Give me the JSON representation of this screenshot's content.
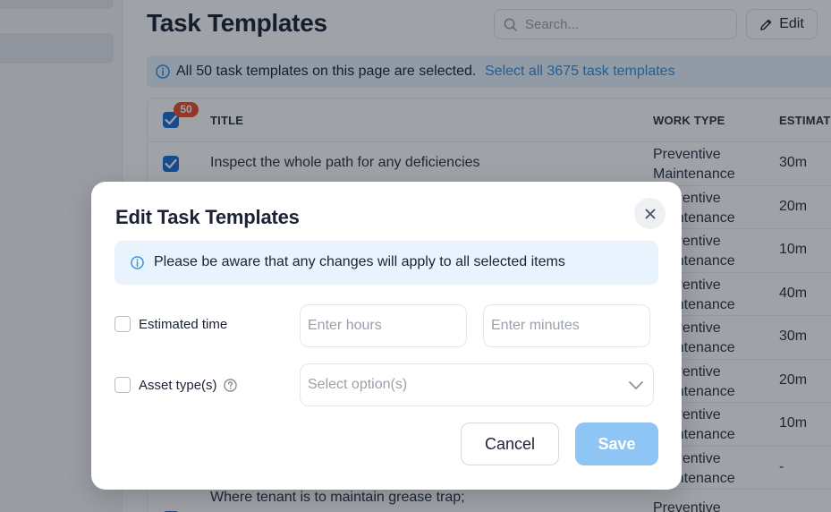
{
  "header": {
    "title": "Task Templates",
    "search_placeholder": "Search...",
    "edit_label": "Edit"
  },
  "selection_banner": {
    "text": "All 50 task templates on this page are selected.",
    "link": "Select all 3675 task templates"
  },
  "table": {
    "selected_count": "50",
    "columns": [
      "TITLE",
      "WORK TYPE",
      "ESTIMATE"
    ],
    "rows": [
      {
        "title": "Inspect the whole path for any deficiencies",
        "work_type": "Preventive Maintenance",
        "estimate": "30m"
      },
      {
        "title": "",
        "work_type": "Preventive Maintenance",
        "estimate": "20m"
      },
      {
        "title": "",
        "work_type": "Preventive Maintenance",
        "estimate": "10m"
      },
      {
        "title": "",
        "work_type": "Preventive Maintenance",
        "estimate": "40m"
      },
      {
        "title": "",
        "work_type": "Preventive Maintenance",
        "estimate": "30m"
      },
      {
        "title": "",
        "work_type": "Preventive Maintenance",
        "estimate": "20m"
      },
      {
        "title": "",
        "work_type": "Preventive Maintenance",
        "estimate": "10m"
      },
      {
        "title": "",
        "work_type": "Preventive Maintenance",
        "estimate": "-"
      },
      {
        "title": "Where tenant is to maintain grease trap;",
        "work_type": "Preventive",
        "estimate": ""
      }
    ]
  },
  "modal": {
    "title": "Edit Task Templates",
    "info": "Please be aware that any changes will apply to all selected items",
    "estimated_time_label": "Estimated time",
    "hours_placeholder": "Enter hours",
    "minutes_placeholder": "Enter minutes",
    "asset_types_label": "Asset type(s)",
    "asset_types_placeholder": "Select option(s)",
    "cancel_label": "Cancel",
    "save_label": "Save"
  },
  "colors": {
    "accent": "#2e8fe6",
    "checkbox": "#1e6ed4",
    "badge": "#e5532d",
    "info_bg": "#e8f3fd",
    "save_disabled": "#8ec5f5"
  },
  "icons": {
    "search": "search-icon",
    "edit": "pencil-icon",
    "info": "info-icon",
    "close": "close-icon",
    "help": "help-circle-icon",
    "chevron": "chevron-down-icon"
  }
}
